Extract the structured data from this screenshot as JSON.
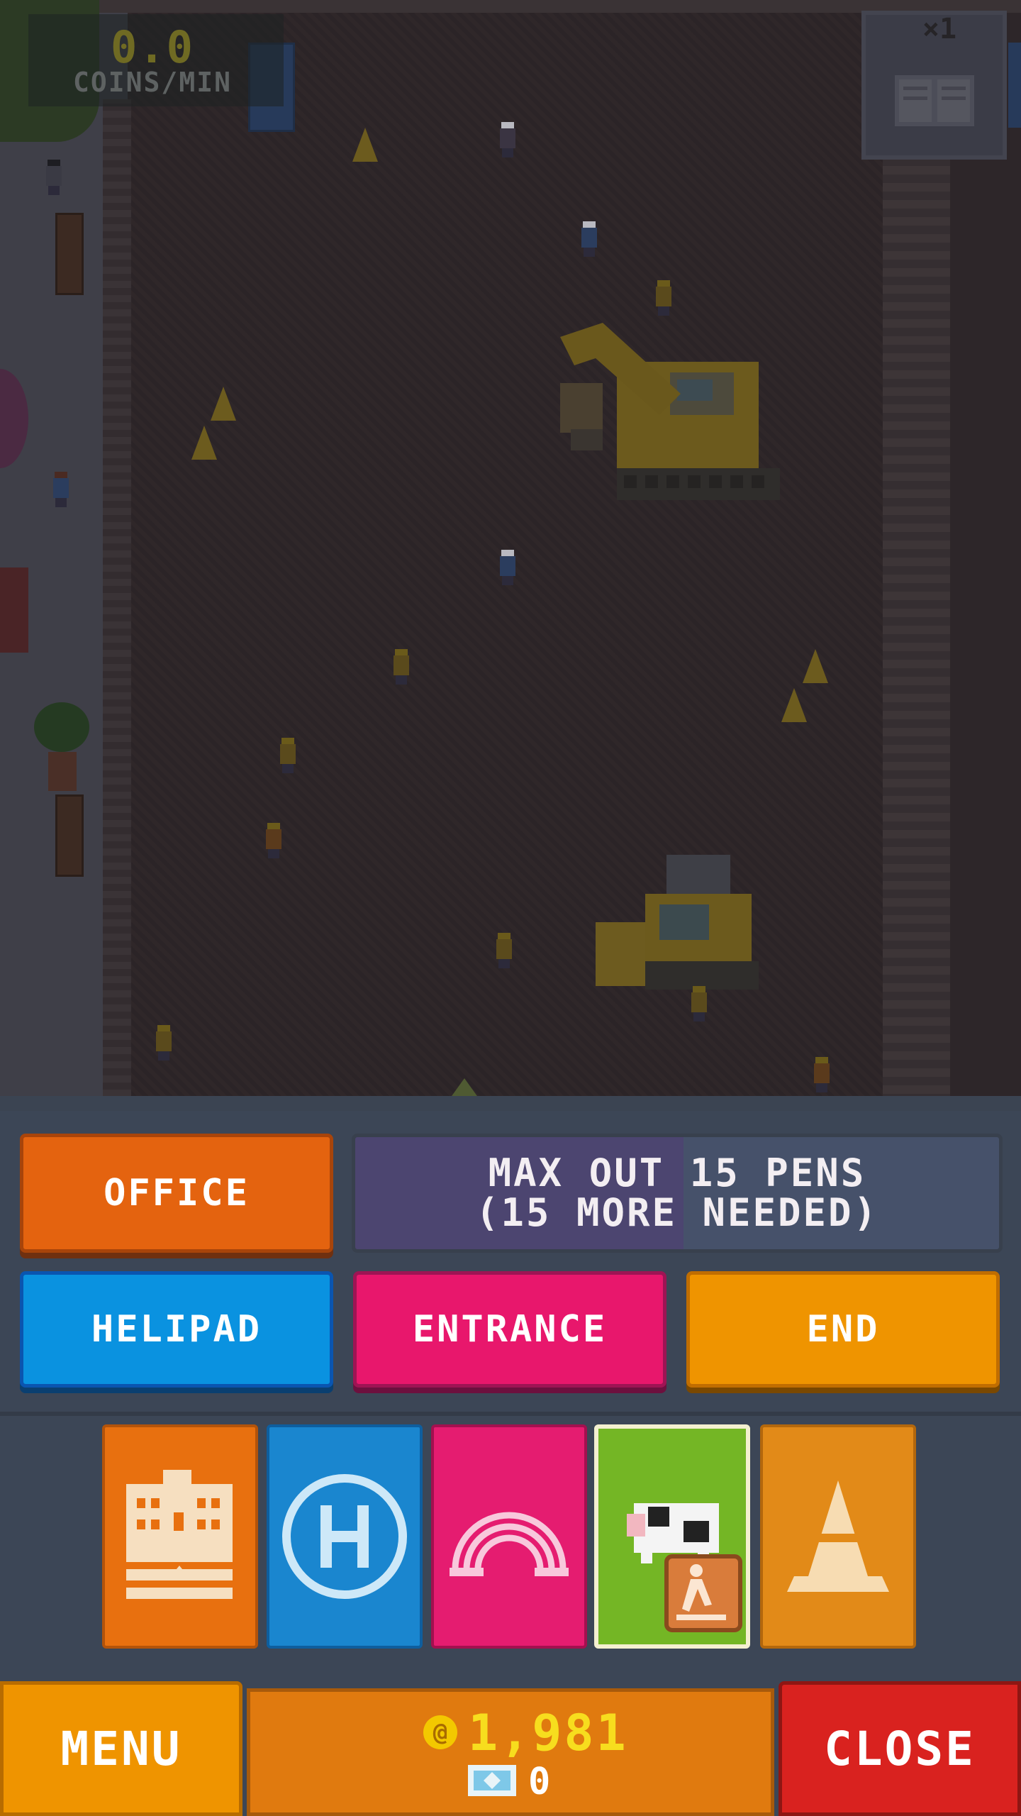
{
  "hud": {
    "coins_per_min_value": "0.0",
    "coins_per_min_label": "COINS/MIN",
    "speed_label": "×1",
    "book_icon": "book-icon"
  },
  "build_menu": {
    "office_label": "OFFICE",
    "goal_line1": "MAX OUT 15 PENS",
    "goal_line2": "(15 MORE NEEDED)",
    "helipad_label": "HELIPAD",
    "entrance_label": "ENTRANCE",
    "end_label": "END"
  },
  "categories": [
    {
      "name": "office",
      "icon": "office-building-icon",
      "color": "#e8700f"
    },
    {
      "name": "helipad",
      "icon": "helipad-icon",
      "color": "#1a86cf"
    },
    {
      "name": "entrance",
      "icon": "rainbow-arch-icon",
      "color": "#e51c70"
    },
    {
      "name": "animals",
      "icon": "cow-construction-icon",
      "color": "#74b625",
      "selected": true
    },
    {
      "name": "decor",
      "icon": "traffic-cone-icon",
      "color": "#e28a18"
    }
  ],
  "bottom_bar": {
    "menu_label": "MENU",
    "close_label": "CLOSE",
    "coins": "1,981",
    "coin_icon": "coin-icon",
    "tickets": "0",
    "ticket_icon": "ticket-icon"
  },
  "colors": {
    "office": "#e4630f",
    "helipad": "#0a92e0",
    "entrance": "#e8176c",
    "end": "#ef9400",
    "close": "#d9221f",
    "coins_text": "#f7dd1e"
  }
}
